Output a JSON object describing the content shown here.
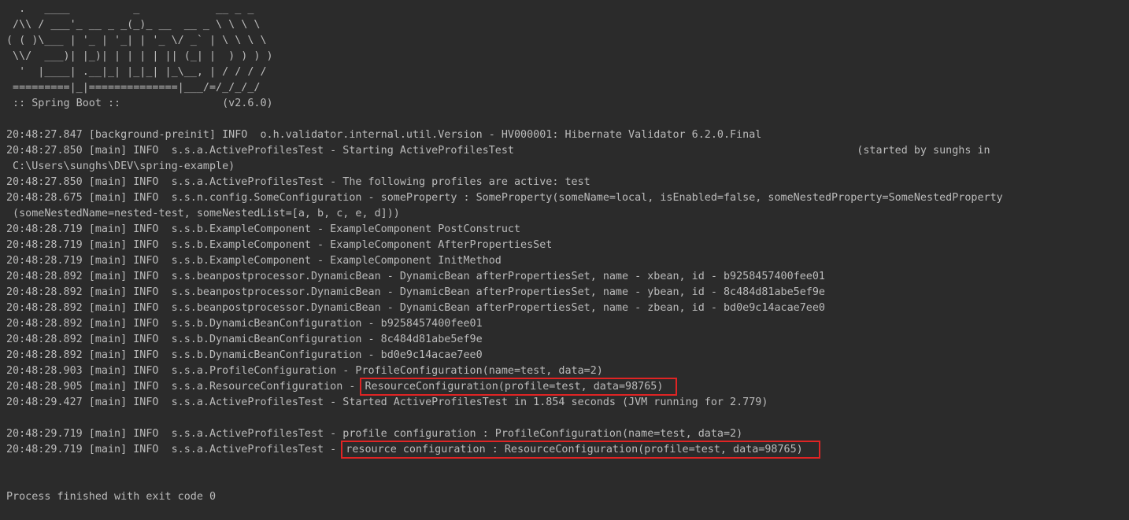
{
  "console": {
    "banner": [
      "  .   ____          _            __ _ _",
      " /\\\\ / ___'_ __ _ _(_)_ __  __ _ \\ \\ \\ \\",
      "( ( )\\___ | '_ | '_| | '_ \\/ _` | \\ \\ \\ \\",
      " \\\\/  ___)| |_)| | | | | || (_| |  ) ) ) )",
      "  '  |____| .__|_| |_|_| |_\\__, | / / / /",
      " =========|_|==============|___/=/_/_/_/",
      " :: Spring Boot ::                (v2.6.0)"
    ],
    "log": [
      "",
      "20:48:27.847 [background-preinit] INFO  o.h.validator.internal.util.Version - HV000001: Hibernate Validator 6.2.0.Final",
      "20:48:27.850 [main] INFO  s.s.a.ActiveProfilesTest - Starting ActiveProfilesTest                                                      (started by sunghs in",
      " C:\\Users\\sunghs\\DEV\\spring-example)",
      "20:48:27.850 [main] INFO  s.s.a.ActiveProfilesTest - The following profiles are active: test",
      "20:48:28.675 [main] INFO  s.s.n.config.SomeConfiguration - someProperty : SomeProperty(someName=local, isEnabled=false, someNestedProperty=SomeNestedProperty",
      " (someNestedName=nested-test, someNestedList=[a, b, c, e, d]))",
      "20:48:28.719 [main] INFO  s.s.b.ExampleComponent - ExampleComponent PostConstruct",
      "20:48:28.719 [main] INFO  s.s.b.ExampleComponent - ExampleComponent AfterPropertiesSet",
      "20:48:28.719 [main] INFO  s.s.b.ExampleComponent - ExampleComponent InitMethod",
      "20:48:28.892 [main] INFO  s.s.beanpostprocessor.DynamicBean - DynamicBean afterPropertiesSet, name - xbean, id - b9258457400fee01",
      "20:48:28.892 [main] INFO  s.s.beanpostprocessor.DynamicBean - DynamicBean afterPropertiesSet, name - ybean, id - 8c484d81abe5ef9e",
      "20:48:28.892 [main] INFO  s.s.beanpostprocessor.DynamicBean - DynamicBean afterPropertiesSet, name - zbean, id - bd0e9c14acae7ee0",
      "20:48:28.892 [main] INFO  s.s.b.DynamicBeanConfiguration - b9258457400fee01",
      "20:48:28.892 [main] INFO  s.s.b.DynamicBeanConfiguration - 8c484d81abe5ef9e",
      "20:48:28.892 [main] INFO  s.s.b.DynamicBeanConfiguration - bd0e9c14acae7ee0",
      "20:48:28.903 [main] INFO  s.s.a.ProfileConfiguration - ProfileConfiguration(name=test, data=2)"
    ],
    "highlight1": {
      "prefix": "20:48:28.905 [main] INFO  s.s.a.ResourceConfiguration - ",
      "text": "ResourceConfiguration(profile=test, data=98765)"
    },
    "log2": [
      "20:48:29.427 [main] INFO  s.s.a.ActiveProfilesTest - Started ActiveProfilesTest in 1.854 seconds (JVM running for 2.779)",
      "",
      "20:48:29.719 [main] INFO  s.s.a.ActiveProfilesTest - profile configuration : ProfileConfiguration(name=test, data=2)"
    ],
    "highlight2": {
      "prefix": "20:48:29.719 [main] INFO  s.s.a.ActiveProfilesTest - ",
      "text": "resource configuration : ResourceConfiguration(profile=test, data=98765)"
    },
    "tail": [
      "",
      "",
      "Process finished with exit code 0"
    ],
    "colors": {
      "background": "#2b2b2b",
      "text": "#bbbbbb",
      "highlight_box": "#e02424"
    }
  }
}
